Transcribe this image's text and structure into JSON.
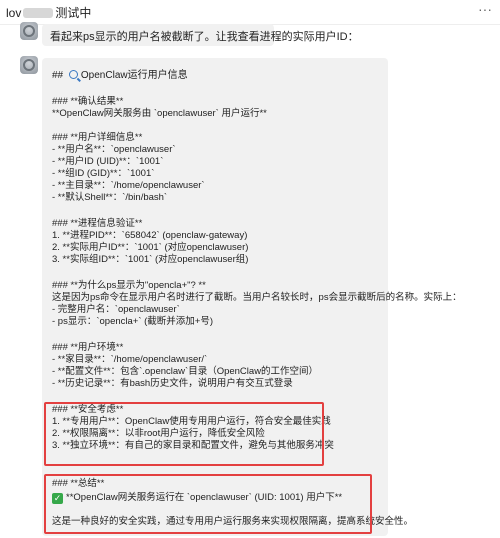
{
  "header": {
    "title_prefix": "lov",
    "title_suffix": "测试中",
    "more_icon": "more-dots-icon"
  },
  "messages": {
    "intro": "看起来ps显示的用户名被截断了。让我查看进程的实际用户ID：",
    "reply": {
      "h_main_prefix": "## ",
      "h_main": "OpenClaw运行用户信息",
      "confirm_title": "### **确认结果**",
      "confirm_line": "**OpenClaw网关服务由 `openclawuser` 用户运行**",
      "details_title": "### **用户详细信息**",
      "details": [
        "- **用户名**：`openclawuser`",
        "- **用户ID (UID)**：`1001`",
        "- **组ID (GID)**：`1001`",
        "- **主目录**：`/home/openclawuser`",
        "- **默认Shell**：`/bin/bash`"
      ],
      "verify_title": "### **进程信息验证**",
      "verify": [
        "1. **进程PID**：`658042` (openclaw-gateway)",
        "2. **实际用户ID**：`1001` (对应openclawuser)",
        "3. **实际组ID**：`1001` (对应openclawuser组)"
      ],
      "why_title": "### **为什么ps显示为\"opencla+\"? **",
      "why": [
        "这是因为ps命令在显示用户名时进行了截断。当用户名较长时，ps会显示截断后的名称。实际上：",
        "- 完整用户名：`openclawuser`",
        "- ps显示：`opencla+` (截断并添加+号)"
      ],
      "env_title": "### **用户环境**",
      "env": [
        "- **家目录**：`/home/openclawuser/`",
        "- **配置文件**：包含`.openclaw`目录（OpenClaw的工作空间）",
        "- **历史记录**：有bash历史文件，说明用户有交互式登录"
      ],
      "security_title": "### **安全考虑**",
      "security": [
        "1. **专用用户**：OpenClaw使用专用用户运行，符合安全最佳实践",
        "2. **权限隔离**：以非root用户运行，降低安全风险",
        "3. **独立环境**：有自己的家目录和配置文件，避免与其他服务冲突"
      ],
      "summary_title": "### **总结**",
      "summary_check": "**OpenClaw网关服务运行在 `openclawuser` (UID: 1001) 用户下**",
      "summary_tail": "这是一种良好的安全实践，通过专用用户运行服务来实现权限隔离，提高系统安全性。"
    }
  },
  "colors": {
    "highlight_box": "#e34040",
    "bubble_bg": "#f1f1f1",
    "check_green": "#36a84a"
  }
}
